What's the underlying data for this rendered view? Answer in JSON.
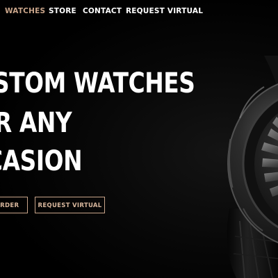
{
  "nav": {
    "items": [
      {
        "label": "WATCHES",
        "active": true
      },
      {
        "label": "STORE",
        "active": false
      },
      {
        "label": "CONTACT",
        "active": false
      },
      {
        "label": "REQUEST VIRTUAL",
        "active": false
      }
    ]
  },
  "hero": {
    "lines": [
      "STOM WATCHES",
      "R ANY",
      "CASION"
    ]
  },
  "cta": {
    "order_label": "ORDER",
    "request_label": "REQUEST VIRTUAL"
  },
  "colors": {
    "background": "#000000",
    "accent": "#c9a58a",
    "text": "#ffffff"
  },
  "images": {
    "hero_watch": "luxury-watch-photo"
  }
}
